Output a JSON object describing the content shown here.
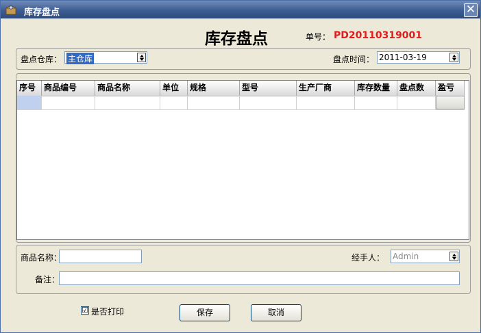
{
  "window": {
    "title": "库存盘点",
    "close_glyph": "✕"
  },
  "header": {
    "title": "库存盘点",
    "order_label": "单号：",
    "order_value": "PD20110319001"
  },
  "top": {
    "warehouse_label": "盘点仓库：",
    "warehouse_value": "主仓库",
    "time_label": "盘点时间：",
    "time_value": "2011-03-19"
  },
  "table": {
    "columns": [
      "序号",
      "商品编号",
      "商品名称",
      "单位",
      "规格",
      "型号",
      "生产厂商",
      "库存数量",
      "盘点数",
      "盈亏"
    ],
    "rows": [
      [
        "",
        "",
        "",
        "",
        "",
        "",
        "",
        "",
        "",
        ""
      ]
    ]
  },
  "bottom": {
    "product_label": "商品名称：",
    "product_value": "",
    "handler_label": "经手人：",
    "handler_value": "Admin",
    "note_label": "备注：",
    "note_value": ""
  },
  "footer": {
    "print_check": "☑",
    "print_label": "是否打印",
    "save_label": "保存",
    "cancel_label": "取消"
  },
  "colors": {
    "order_value": "#e01c1c",
    "titlebar": "#3d5d92",
    "selection": "#316ac5"
  },
  "icons": [
    "app-icon",
    "close-icon",
    "chevron-updown-icon",
    "checkbox-checked-icon"
  ]
}
